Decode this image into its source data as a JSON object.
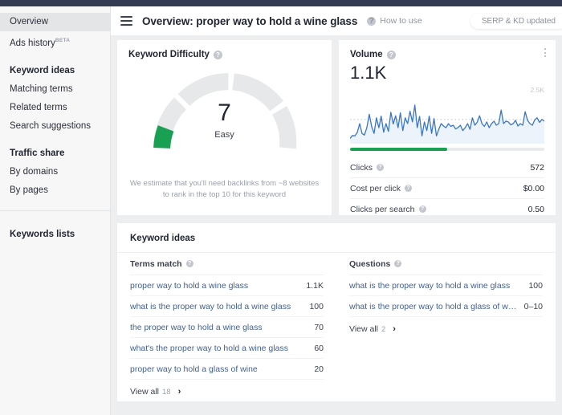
{
  "topbar": {
    "color": "#323b52"
  },
  "sidebar": {
    "items": [
      {
        "label": "Overview",
        "type": "item",
        "selected": true
      },
      {
        "label": "Ads history",
        "type": "item",
        "badge": "BETA"
      },
      {
        "label": "Keyword ideas",
        "type": "head"
      },
      {
        "label": "Matching terms",
        "type": "item"
      },
      {
        "label": "Related terms",
        "type": "item"
      },
      {
        "label": "Search suggestions",
        "type": "item"
      },
      {
        "label": "Traffic share",
        "type": "head"
      },
      {
        "label": "By domains",
        "type": "item"
      },
      {
        "label": "By pages",
        "type": "item"
      },
      {
        "label": "Keywords lists",
        "type": "head"
      }
    ]
  },
  "header": {
    "menu_icon": "hamburger-icon",
    "title": "Overview: proper way to hold a wine glass",
    "howto_label": "How to use",
    "howto_icon": "help-circle-icon",
    "badge": "SERP & KD updated"
  },
  "keyword_difficulty": {
    "title": "Keyword Difficulty",
    "help_icon": "help-circle-icon",
    "score": "7",
    "level": "Easy",
    "note": "We estimate that you'll need backlinks from ~8 websites to rank in the top 10 for this keyword",
    "gauge": {
      "value": 7,
      "max": 100,
      "fill_color": "#1aa053",
      "track_color": "#e6e8ea",
      "segments": 4
    }
  },
  "volume": {
    "title": "Volume",
    "help_icon": "help-circle-icon",
    "menu_icon": "kebab-menu-icon",
    "value": "1.1K",
    "chart_max_label": "2.5K",
    "progress_percent": 50,
    "progress_color": "#1aa053",
    "metrics": [
      {
        "label": "Clicks",
        "value": "572",
        "help_icon": "help-circle-icon"
      },
      {
        "label": "Cost per click",
        "value": "$0.00",
        "help_icon": "help-circle-icon"
      },
      {
        "label": "Clicks per search",
        "value": "0.50",
        "help_icon": "help-circle-icon"
      }
    ]
  },
  "chart_data": {
    "type": "line",
    "title": "Volume",
    "xlabel": "",
    "ylabel": "",
    "ylim": [
      0,
      2500
    ],
    "grid": false,
    "legend": false,
    "line_color": "#3b76c4",
    "fill_color": "#eaf1fa",
    "average_line": 1100,
    "annotations": [
      {
        "text": "2.5K",
        "position": "top-right"
      }
    ],
    "values": [
      180,
      320,
      300,
      470,
      900,
      420,
      340,
      700,
      1350,
      760,
      420,
      1180,
      700,
      1260,
      480,
      900,
      520,
      1450,
      880,
      1280,
      700,
      1420,
      560,
      1180,
      900,
      1500,
      980,
      1800,
      700,
      1250,
      300,
      980,
      560,
      1260,
      420,
      1150,
      300,
      620,
      900,
      780,
      700,
      900,
      760,
      820,
      640,
      700,
      820,
      560,
      700,
      900,
      620,
      1180,
      820,
      960,
      1280,
      900,
      760,
      980,
      700,
      900,
      1020,
      820,
      900,
      1560,
      900,
      1020,
      980,
      840,
      900,
      1060,
      780,
      900,
      820,
      1480,
      1060,
      900,
      820,
      1080,
      1180,
      960,
      1100,
      1020
    ]
  },
  "keyword_ideas": {
    "title": "Keyword ideas",
    "columns": [
      {
        "header": "Terms match",
        "help_icon": "help-circle-icon",
        "rows": [
          {
            "keyword": "proper way to hold a wine glass",
            "volume": "1.1K"
          },
          {
            "keyword": "what is the proper way to hold a wine glass",
            "volume": "100"
          },
          {
            "keyword": "the proper way to hold a wine glass",
            "volume": "70"
          },
          {
            "keyword": "what's the proper way to hold a wine glass",
            "volume": "60"
          },
          {
            "keyword": "proper way to hold a glass of wine",
            "volume": "20"
          }
        ],
        "view_all_label": "View all",
        "view_all_count": "18"
      },
      {
        "header": "Questions",
        "help_icon": "help-circle-icon",
        "rows": [
          {
            "keyword": "what is the proper way to hold a wine glass",
            "volume": "100"
          },
          {
            "keyword": "what is the proper way to hold a glass of wine",
            "volume": "0–10"
          }
        ],
        "view_all_label": "View all",
        "view_all_count": "2"
      }
    ]
  }
}
